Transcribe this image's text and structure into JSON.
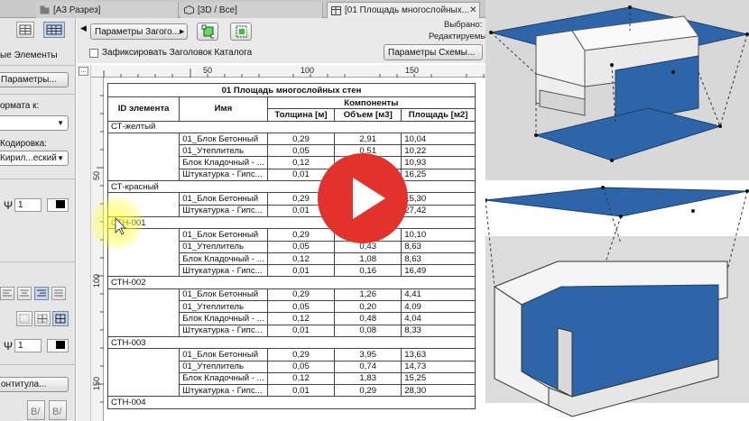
{
  "tabs": [
    {
      "label": "[A3 Разрез]",
      "icon": "folder-icon"
    },
    {
      "label": "[3D / Все]",
      "icon": "cube-icon"
    },
    {
      "label": "[01 Площадь многослойных...",
      "icon": "schedule-icon"
    }
  ],
  "left_panel": {
    "elements_label": "ые Элементы",
    "params_button": "Параметры...",
    "format_label": "ормата к:",
    "format_value": "",
    "encoding_label": "Кодировка:",
    "encoding_value": "Кирил...еский",
    "pen_value_1": "1",
    "pen_value_2": "1",
    "footer_button": "онтитула..."
  },
  "toolbar": {
    "header_params_button": "Параметры Загого...",
    "lock_header_label": "Зафиксировать Заголовок Каталога",
    "scheme_params_button": "Параметры Схемы...",
    "selected_label": "Выбрано:",
    "editable_label": "Редактируемых:",
    "more_button": "..."
  },
  "ruler": {
    "top_marks": [
      "50",
      "100",
      "150"
    ],
    "left_marks": [
      "50",
      "100",
      "150"
    ]
  },
  "schedule": {
    "title": "01 Площадь многослойных стен",
    "headers": {
      "id": "ID элемента",
      "name": "Имя",
      "components": "Компоненты",
      "thickness": "Толщина [м]",
      "volume": "Объем [м3]",
      "area": "Площадь [м2]"
    },
    "groups": [
      {
        "id": "СТ-желтый",
        "rows": [
          [
            "01_Блок Бетонный",
            "0,29",
            "2,91",
            "10,04"
          ],
          [
            "01_Утеплитель",
            "0,05",
            "0,51",
            "10,22"
          ],
          [
            "Блок Кладочный - ...",
            "0,12",
            "1,31",
            "10,93"
          ],
          [
            "Штукатурка - Гипс...",
            "0,01",
            "0,19",
            "16,25"
          ]
        ]
      },
      {
        "id": "СТ-красный",
        "rows": [
          [
            "01_Блок Бетонный",
            "0,29",
            "4,43",
            "15,30"
          ],
          [
            "Штукатурка - Гипс...",
            "0,01",
            "0,27",
            "27,42"
          ]
        ]
      },
      {
        "id": "СТН-001",
        "rows": [
          [
            "01_Блок Бетонный",
            "0,29",
            "2,83",
            "10,10"
          ],
          [
            "01_Утеплитель",
            "0,05",
            "0,43",
            "8,63"
          ],
          [
            "Блок Кладочный - ...",
            "0,12",
            "1,08",
            "8,63"
          ],
          [
            "Штукатурка - Гипс...",
            "0,01",
            "0,16",
            "16,49"
          ]
        ]
      },
      {
        "id": "СТН-002",
        "rows": [
          [
            "01_Блок Бетонный",
            "0,29",
            "1,26",
            "4,41"
          ],
          [
            "01_Утеплитель",
            "0,05",
            "0,20",
            "4,09"
          ],
          [
            "Блок Кладочный - ...",
            "0,12",
            "0,48",
            "4,04"
          ],
          [
            "Штукатурка - Гипс...",
            "0,01",
            "0,08",
            "8,33"
          ]
        ]
      },
      {
        "id": "СТН-003",
        "rows": [
          [
            "01_Блок Бетонный",
            "0,29",
            "3,95",
            "13,63"
          ],
          [
            "01_Утеплитель",
            "0,05",
            "0,74",
            "14,73"
          ],
          [
            "Блок Кладочный - ...",
            "0,12",
            "1,83",
            "15,25"
          ],
          [
            "Штукатурка - Гипс...",
            "0,01",
            "0,29",
            "28,30"
          ]
        ]
      },
      {
        "id": "СТН-004",
        "rows": []
      }
    ]
  },
  "colors": {
    "accent_blue": "#2f6aa8",
    "play_red": "#e3322b",
    "panel_gray": "#e6e6e6"
  }
}
